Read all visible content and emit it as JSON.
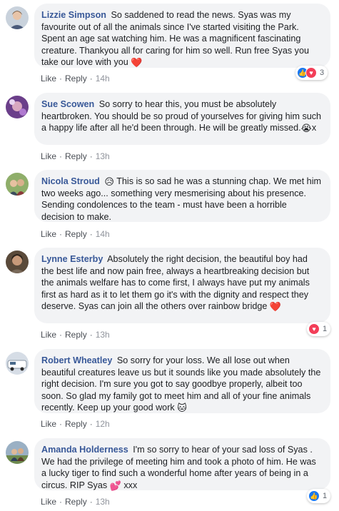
{
  "actions": {
    "like": "Like",
    "reply": "Reply",
    "sep": "·"
  },
  "colors": {
    "name": "#385898",
    "bubble": "#f2f3f5",
    "meta": "#606770",
    "like": "#1877f2",
    "love": "#f33e58"
  },
  "comments": [
    {
      "author": "Lizzie Simpson",
      "text": "So saddened to read the news. Syas was my favourite out of all the animals since I've started visiting the Park. Spent an age sat watching him. He was a magnificent fascinating creature. Thankyou all for caring for him so well. Run free Syas you take our love with you",
      "emoji": "❤️",
      "emoji_name": "heart-emoji",
      "time": "14h",
      "reactions": {
        "icons": [
          "like-icon",
          "love-icon"
        ],
        "count": "3"
      }
    },
    {
      "author": "Sue Scowen",
      "text": "So sorry to hear this, you must be absolutely heartbroken. You should be so proud of yourselves for giving him such a happy life after all he'd been through. He will be greatly missed.",
      "emoji": "😭",
      "emoji_name": "crying-face-emoji",
      "suffix": "x",
      "time": "13h"
    },
    {
      "author": "Nicola Stroud",
      "text_prefix_emoji": "😥",
      "text": "This is so sad he was a stunning chap. We met him two weeks ago... something very mesmerising about his presence. Sending condolences to the team - must have been a horrible decision to make.",
      "time": "14h"
    },
    {
      "author": "Lynne Esterby",
      "text": "Absolutely the right decision, the beautiful boy had the best life and now pain free, always a heartbreaking decision but the animals welfare has to come first, I always have put my animals first as hard as it to let them go it's with the dignity and respect they deserve. Syas can join all the others over rainbow bridge",
      "emoji": "❤️",
      "emoji_name": "heart-emoji",
      "time": "13h",
      "reactions": {
        "icons": [
          "love-icon"
        ],
        "count": "1"
      }
    },
    {
      "author": "Robert Wheatley",
      "text": "So sorry for your loss. We all lose out when beautiful creatures leave us but it sounds like you made absolutely the right decision. I'm sure you got to say goodbye properly, albeit too soon. So glad my family got to meet him and all of your fine animals recently. Keep up your good work",
      "emoji": "🐱",
      "emoji_name": "cat-face-emoji",
      "time": "12h"
    },
    {
      "author": "Amanda Holderness",
      "text": "I'm so sorry to hear of your sad loss of Syas . We had the privilege of meeting him and took a photo of him. He was a lucky tiger to find such a wonderful home after years of being in a circus. RIP Syas",
      "emoji": "💕",
      "emoji_name": "two-hearts-emoji",
      "suffix": "xxx",
      "time": "13h",
      "reactions": {
        "icons": [
          "like-icon"
        ],
        "count": "1"
      }
    }
  ]
}
